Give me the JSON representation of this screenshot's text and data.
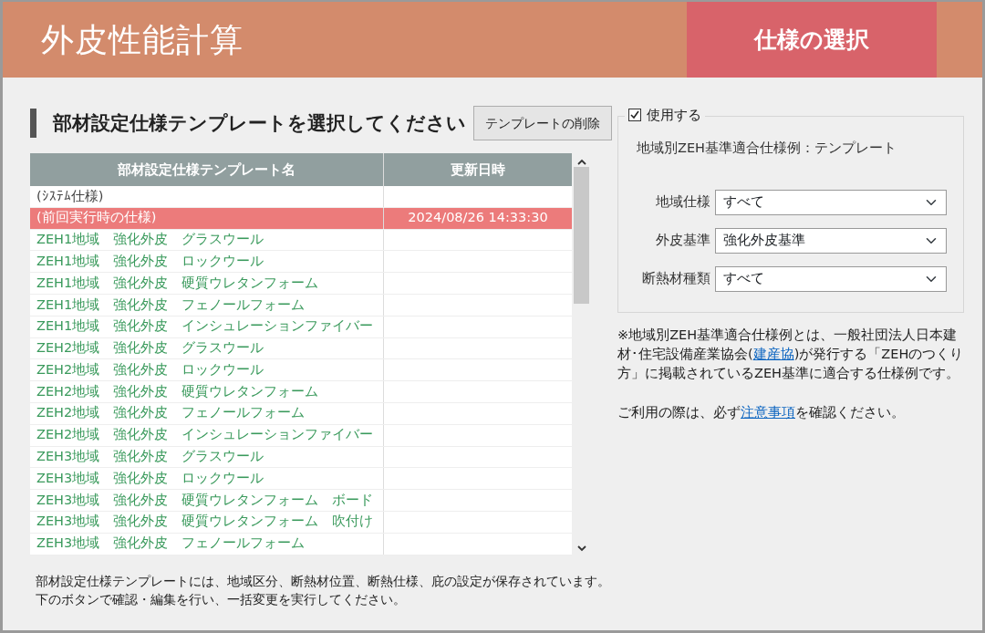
{
  "header": {
    "title": "外皮性能計算",
    "tabs": [
      {
        "label": "仕様の選択",
        "selected": true
      }
    ]
  },
  "heading": "部材設定仕様テンプレートを選択してください",
  "delete_button": "テンプレートの削除",
  "table": {
    "columns": [
      "部材設定仕様テンプレート名",
      "更新日時"
    ],
    "rows": [
      {
        "name": "(ｼｽﾃﾑ仕様)",
        "updated": "",
        "kind": "system",
        "selected": false
      },
      {
        "name": "(前回実行時の仕様)",
        "updated": "2024/08/26 14:33:30",
        "kind": "system",
        "selected": true
      },
      {
        "name": "ZEH1地域　強化外皮　グラスウール",
        "updated": "",
        "kind": "template",
        "selected": false
      },
      {
        "name": "ZEH1地域　強化外皮　ロックウール",
        "updated": "",
        "kind": "template",
        "selected": false
      },
      {
        "name": "ZEH1地域　強化外皮　硬質ウレタンフォーム",
        "updated": "",
        "kind": "template",
        "selected": false
      },
      {
        "name": "ZEH1地域　強化外皮　フェノールフォーム",
        "updated": "",
        "kind": "template",
        "selected": false
      },
      {
        "name": "ZEH1地域　強化外皮　インシュレーションファイバー",
        "updated": "",
        "kind": "template",
        "selected": false
      },
      {
        "name": "ZEH2地域　強化外皮　グラスウール",
        "updated": "",
        "kind": "template",
        "selected": false
      },
      {
        "name": "ZEH2地域　強化外皮　ロックウール",
        "updated": "",
        "kind": "template",
        "selected": false
      },
      {
        "name": "ZEH2地域　強化外皮　硬質ウレタンフォーム",
        "updated": "",
        "kind": "template",
        "selected": false
      },
      {
        "name": "ZEH2地域　強化外皮　フェノールフォーム",
        "updated": "",
        "kind": "template",
        "selected": false
      },
      {
        "name": "ZEH2地域　強化外皮　インシュレーションファイバー",
        "updated": "",
        "kind": "template",
        "selected": false
      },
      {
        "name": "ZEH3地域　強化外皮　グラスウール",
        "updated": "",
        "kind": "template",
        "selected": false
      },
      {
        "name": "ZEH3地域　強化外皮　ロックウール",
        "updated": "",
        "kind": "template",
        "selected": false
      },
      {
        "name": "ZEH3地域　強化外皮　硬質ウレタンフォーム　ボード",
        "updated": "",
        "kind": "template",
        "selected": false
      },
      {
        "name": "ZEH3地域　強化外皮　硬質ウレタンフォーム　吹付け",
        "updated": "",
        "kind": "template",
        "selected": false
      },
      {
        "name": "ZEH3地域　強化外皮　フェノールフォーム",
        "updated": "",
        "kind": "template",
        "selected": false
      }
    ]
  },
  "filter": {
    "checkbox": {
      "label": "使用する",
      "checked": true
    },
    "subtitle": "地域別ZEH基準適合仕様例：テンプレート",
    "fields": [
      {
        "label": "地域仕様",
        "value": "すべて"
      },
      {
        "label": "外皮基準",
        "value": "強化外皮基準"
      },
      {
        "label": "断熱材種類",
        "value": "すべて"
      }
    ]
  },
  "notes": [
    [
      {
        "kind": "text",
        "text": "※地域別ZEH基準適合仕様例とは、一般社団法人日本建材･住宅設備産業協会("
      },
      {
        "kind": "link",
        "text": "建産協"
      },
      {
        "kind": "text",
        "text": ")が発行する「ZEHのつくり方」に掲載されているZEH基準に適合する仕様例です。"
      }
    ],
    [
      {
        "kind": "text",
        "text": "ご利用の際は、必ず"
      },
      {
        "kind": "link",
        "text": "注意事項"
      },
      {
        "kind": "text",
        "text": "を確認ください。"
      }
    ]
  ],
  "footer": [
    "部材設定仕様テンプレートには、地域区分、断熱材位置、断熱仕様、庇の設定が保存されています。",
    "下のボタンで確認・編集を行い、一括変更を実行してください。"
  ]
}
